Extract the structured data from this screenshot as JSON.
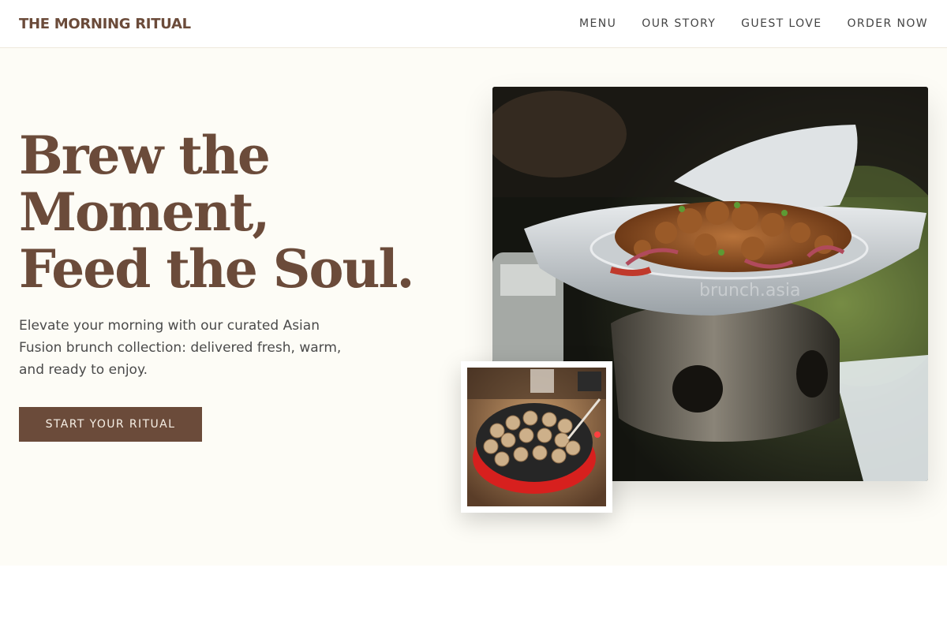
{
  "header": {
    "brand": "THE MORNING RITUAL",
    "nav": [
      {
        "label": "MENU"
      },
      {
        "label": "OUR STORY"
      },
      {
        "label": "GUEST LOVE"
      },
      {
        "label": "ORDER NOW"
      }
    ]
  },
  "hero": {
    "headline_lines": [
      "Brew the",
      "Moment,",
      "Feed the Soul."
    ],
    "description": "Elevate your morning with our curated Asian Fusion brunch collection: delivered fresh, warm, and ready to enjoy.",
    "cta_label": "START YOUR RITUAL",
    "main_photo": {
      "icon": "sizzling-plate-photo",
      "watermark": "brunch.asia"
    },
    "secondary_photo": {
      "icon": "takoyaki-pan-photo"
    }
  },
  "colors": {
    "brand_brown": "#6b4b3a",
    "hero_background": "#fdfcf6",
    "cta_text": "#f6efe5"
  }
}
